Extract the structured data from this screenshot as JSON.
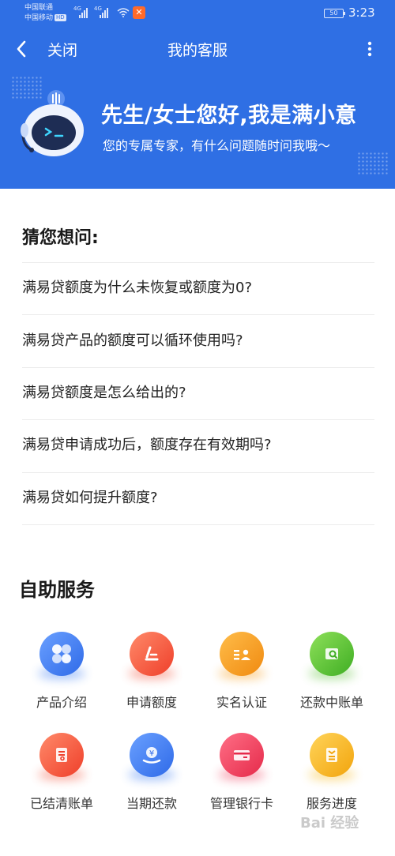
{
  "status_bar": {
    "carrier_1": "中国联通",
    "carrier_2": "中国移动",
    "hd_badge": "HD",
    "network_1": "4G",
    "network_2": "4G",
    "battery": "50",
    "time": "3:23"
  },
  "nav": {
    "close_label": "关闭",
    "title": "我的客服"
  },
  "banner": {
    "greeting": "先生/女士您好,我是满小意",
    "subtitle": "您的专属专家，有什么问题随时问我哦～"
  },
  "faq": {
    "title": "猜您想问:",
    "questions": [
      "满易贷额度为什么未恢复或额度为0?",
      "满易贷产品的额度可以循环使用吗?",
      "满易贷额度是怎么给出的?",
      "满易贷申请成功后，额度存在有效期吗?",
      "满易贷如何提升额度?"
    ]
  },
  "services": {
    "title": "自助服务",
    "items": [
      {
        "label": "产品介绍",
        "icon": "grid-icon",
        "color": "#3d7cf2"
      },
      {
        "label": "申请额度",
        "icon": "edit-icon",
        "color": "#f4513a"
      },
      {
        "label": "实名认证",
        "icon": "id-card-icon",
        "color": "#f79a15"
      },
      {
        "label": "还款中账单",
        "icon": "bill-search-icon",
        "color": "#5cc236"
      },
      {
        "label": "已结清账单",
        "icon": "document-icon",
        "color": "#f4513a"
      },
      {
        "label": "当期还款",
        "icon": "yen-hand-icon",
        "color": "#3d7cf2"
      },
      {
        "label": "管理银行卡",
        "icon": "bank-card-icon",
        "color": "#ef3a5a"
      },
      {
        "label": "服务进度",
        "icon": "progress-icon",
        "color": "#f7b918"
      }
    ]
  },
  "watermark": "Bai 经验"
}
